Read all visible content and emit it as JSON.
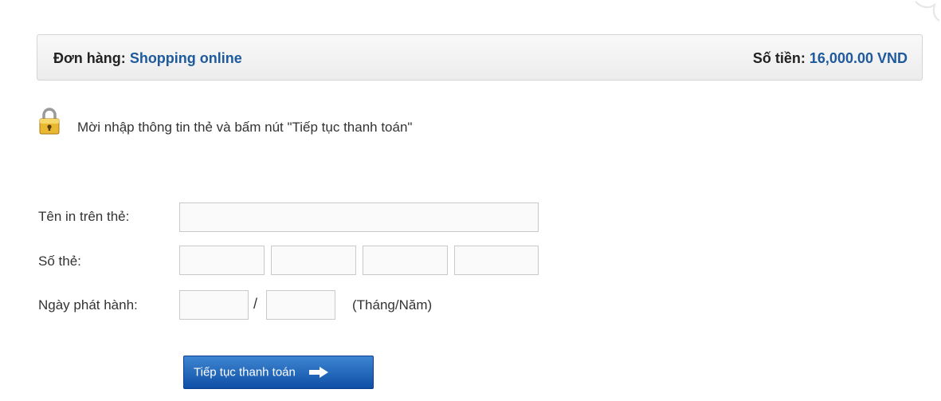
{
  "order": {
    "label": "Đơn hàng:",
    "value": "Shopping online",
    "amount_label": "Số tiền:",
    "amount_value": "16,000.00 VND"
  },
  "instruction": "Mời nhập thông tin thẻ và bấm nút \"Tiếp tục thanh toán\"",
  "form": {
    "name_label": "Tên in trên thẻ:",
    "card_number_label": "Số thẻ:",
    "issue_date_label": "Ngày phát hành:",
    "date_separator": "/",
    "date_hint": "(Tháng/Năm)",
    "name_value": "",
    "card_number_values": [
      "",
      "",
      "",
      ""
    ],
    "issue_month_value": "",
    "issue_year_value": ""
  },
  "submit": {
    "label": "Tiếp tục thanh toán",
    "icon": "arrow-right-icon"
  },
  "icons": {
    "lock": "lock-icon"
  },
  "colors": {
    "accent": "#1f5a9c",
    "button": "#1a5fb4"
  }
}
